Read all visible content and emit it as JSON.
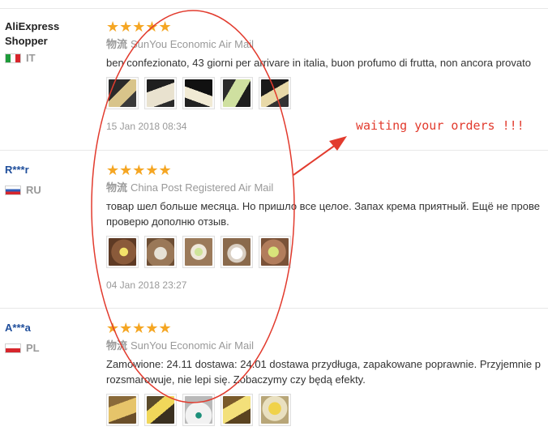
{
  "reviews": [
    {
      "user": "AliExpress\nShopper",
      "country": "IT",
      "stars": "★★★★★",
      "ship_icon": "物流",
      "shipping": "SunYou Economic Air Mail",
      "text": "ben confezionato, 43 giorni per arrivare in italia, buon profumo di frutta, non ancora provato",
      "date": "15 Jan 2018 08:34"
    },
    {
      "user": "R***r",
      "country": "RU",
      "stars": "★★★★★",
      "ship_icon": "物流",
      "shipping": "China Post Registered Air Mail",
      "text_line1": "товар шел больше месяца. Но пришло все целое. Запах крема приятный. Ещё не прове",
      "text_line2": "проверю дополню отзыв.",
      "date": "04 Jan 2018 23:27"
    },
    {
      "user": "A***a",
      "country": "PL",
      "stars": "★★★★★",
      "ship_icon": "物流",
      "shipping": "SunYou Economic Air Mail",
      "text_line1": "Zamówione: 24.11 dostawa: 24.01 dostawa przydługa, zapakowane poprawnie. Przyjemnie p",
      "text_line2": "rozsmarowuje, nie lepi się. Zobaczymy czy będą efekty."
    }
  ],
  "annotation": {
    "note": "waiting your orders !!!",
    "color": "#e23b2e"
  },
  "colors": {
    "star": "#f5a623",
    "link_user": "#1f4e9b",
    "meta_gray": "#999999"
  }
}
